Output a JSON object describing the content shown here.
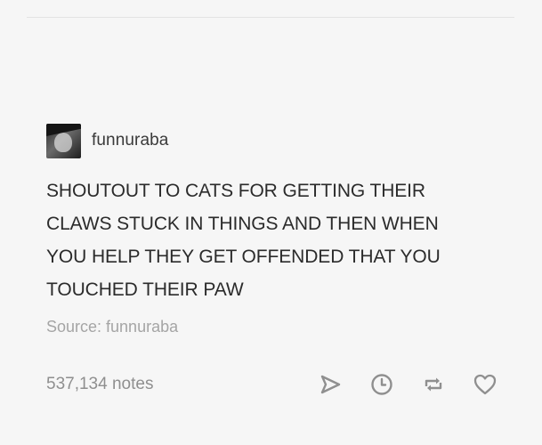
{
  "post": {
    "username": "funnuraba",
    "body_lines": [
      "SHOUTOUT TO CATS FOR GETTING THEIR",
      "CLAWS STUCK IN THINGS AND THEN WHEN",
      "YOU HELP THEY GET OFFENDED THAT YOU",
      "TOUCHED THEIR PAW"
    ],
    "source": "Source: funnuraba"
  },
  "footer": {
    "notes": "537,134 notes",
    "actions": [
      "share-icon",
      "clock-icon",
      "reblog-icon",
      "heart-icon"
    ]
  },
  "colors": {
    "background": "#f6f6f6",
    "text": "#2b2b2b",
    "muted": "#a5a5a5",
    "icon": "#8f8f8f"
  }
}
